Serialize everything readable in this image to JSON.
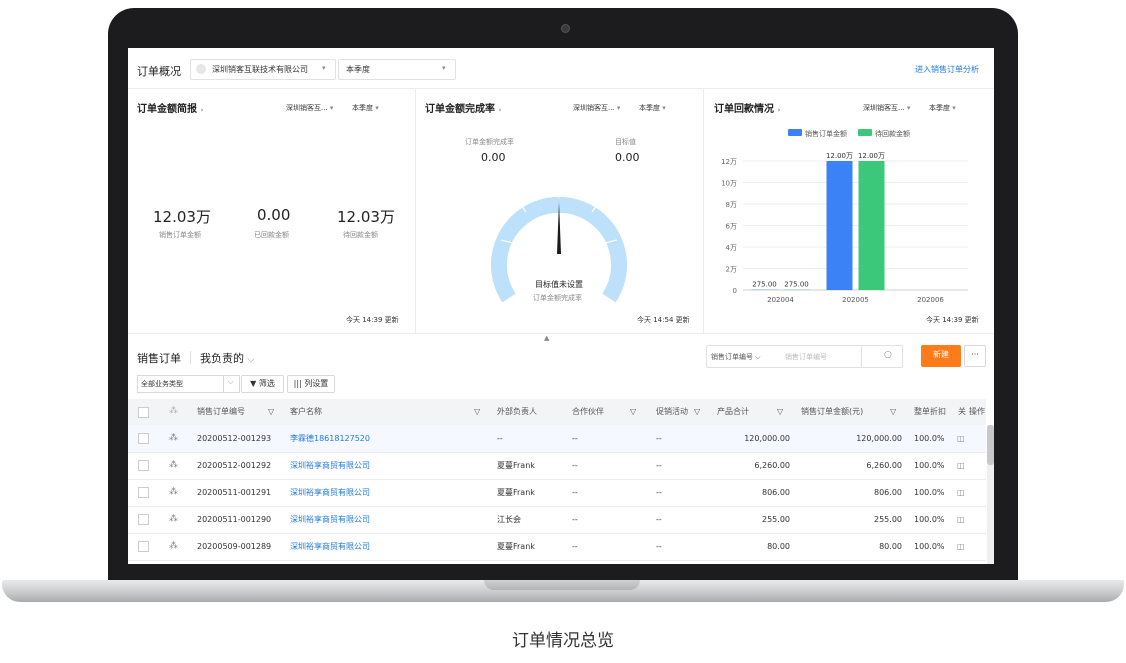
{
  "header": {
    "title": "订单概况",
    "company": "深圳销客互联技术有限公司",
    "period": "本季度",
    "link": "进入销售订单分析"
  },
  "report": {
    "title": "订单金额简报",
    "filter_company": "深圳销客互...",
    "filter_period": "本季度",
    "metrics": [
      {
        "value": "12.03万",
        "label": "销售订单金额"
      },
      {
        "value": "0.00",
        "label": "已回款金额"
      },
      {
        "value": "12.03万",
        "label": "待回款金额"
      }
    ],
    "updated": "今天 14:39 更新"
  },
  "completion": {
    "title": "订单金额完成率",
    "filter_company": "深圳销客互...",
    "filter_period": "本季度",
    "rate_label": "订单金额完成率",
    "rate_value": "0.00",
    "target_label": "目标值",
    "target_value": "0.00",
    "gauge_text": "目标值未设置",
    "gauge_sub": "订单金额完成率",
    "gauge_level": 0,
    "updated": "今天 14:54 更新"
  },
  "payment": {
    "title": "订单回款情况",
    "filter_company": "深圳销客互...",
    "filter_period": "本季度",
    "updated": "今天 14:39 更新"
  },
  "chart_data": {
    "type": "bar",
    "categories": [
      "202004",
      "202005",
      "202006"
    ],
    "series": [
      {
        "name": "销售订单金额",
        "values": [
          275,
          120000,
          0
        ],
        "labels": [
          "275.00",
          "12.00万",
          ""
        ],
        "color": "#3b82f6"
      },
      {
        "name": "待回款金额",
        "values": [
          275,
          120000,
          0
        ],
        "labels": [
          "275.00",
          "12.00万",
          ""
        ],
        "color": "#3cc87a"
      }
    ],
    "yticks": [
      "0",
      "2万",
      "4万",
      "6万",
      "8万",
      "10万",
      "12万"
    ],
    "ylim": [
      0,
      120000
    ],
    "grid": true,
    "legend": "top-center"
  },
  "orders": {
    "title": "销售订单",
    "scope": "我负责的",
    "type_filter": "全部业务类型",
    "filter_btn": "筛选",
    "columns_btn": "列设置",
    "search_field": "销售订单编号",
    "search_placeholder": "销售订单编号",
    "new_btn": "新建",
    "more_btn": "···",
    "headers": [
      "销售订单编号",
      "客户名称",
      "外部负责人",
      "合作伙伴",
      "促销活动",
      "产品合计",
      "销售订单金额(元)",
      "整单折扣",
      "关",
      "操作"
    ],
    "rows": [
      {
        "no": "20200512-001293",
        "customer": "李霖德18618127520",
        "owner": "--",
        "partner": "--",
        "promo": "--",
        "total": "120,000.00",
        "amount": "120,000.00",
        "discount": "100.0%"
      },
      {
        "no": "20200512-001292",
        "customer": "深圳裕享商贸有限公司",
        "owner": "夏蔓Frank",
        "partner": "--",
        "promo": "--",
        "total": "6,260.00",
        "amount": "6,260.00",
        "discount": "100.0%"
      },
      {
        "no": "20200511-001291",
        "customer": "深圳裕享商贸有限公司",
        "owner": "夏蔓Frank",
        "partner": "--",
        "promo": "--",
        "total": "806.00",
        "amount": "806.00",
        "discount": "100.0%"
      },
      {
        "no": "20200511-001290",
        "customer": "深圳裕享商贸有限公司",
        "owner": "江长会",
        "partner": "--",
        "promo": "--",
        "total": "255.00",
        "amount": "255.00",
        "discount": "100.0%"
      },
      {
        "no": "20200509-001289",
        "customer": "深圳裕享商贸有限公司",
        "owner": "夏蔓Frank",
        "partner": "--",
        "promo": "--",
        "total": "80.00",
        "amount": "80.00",
        "discount": "100.0%"
      }
    ]
  },
  "caption": "订单情况总览"
}
